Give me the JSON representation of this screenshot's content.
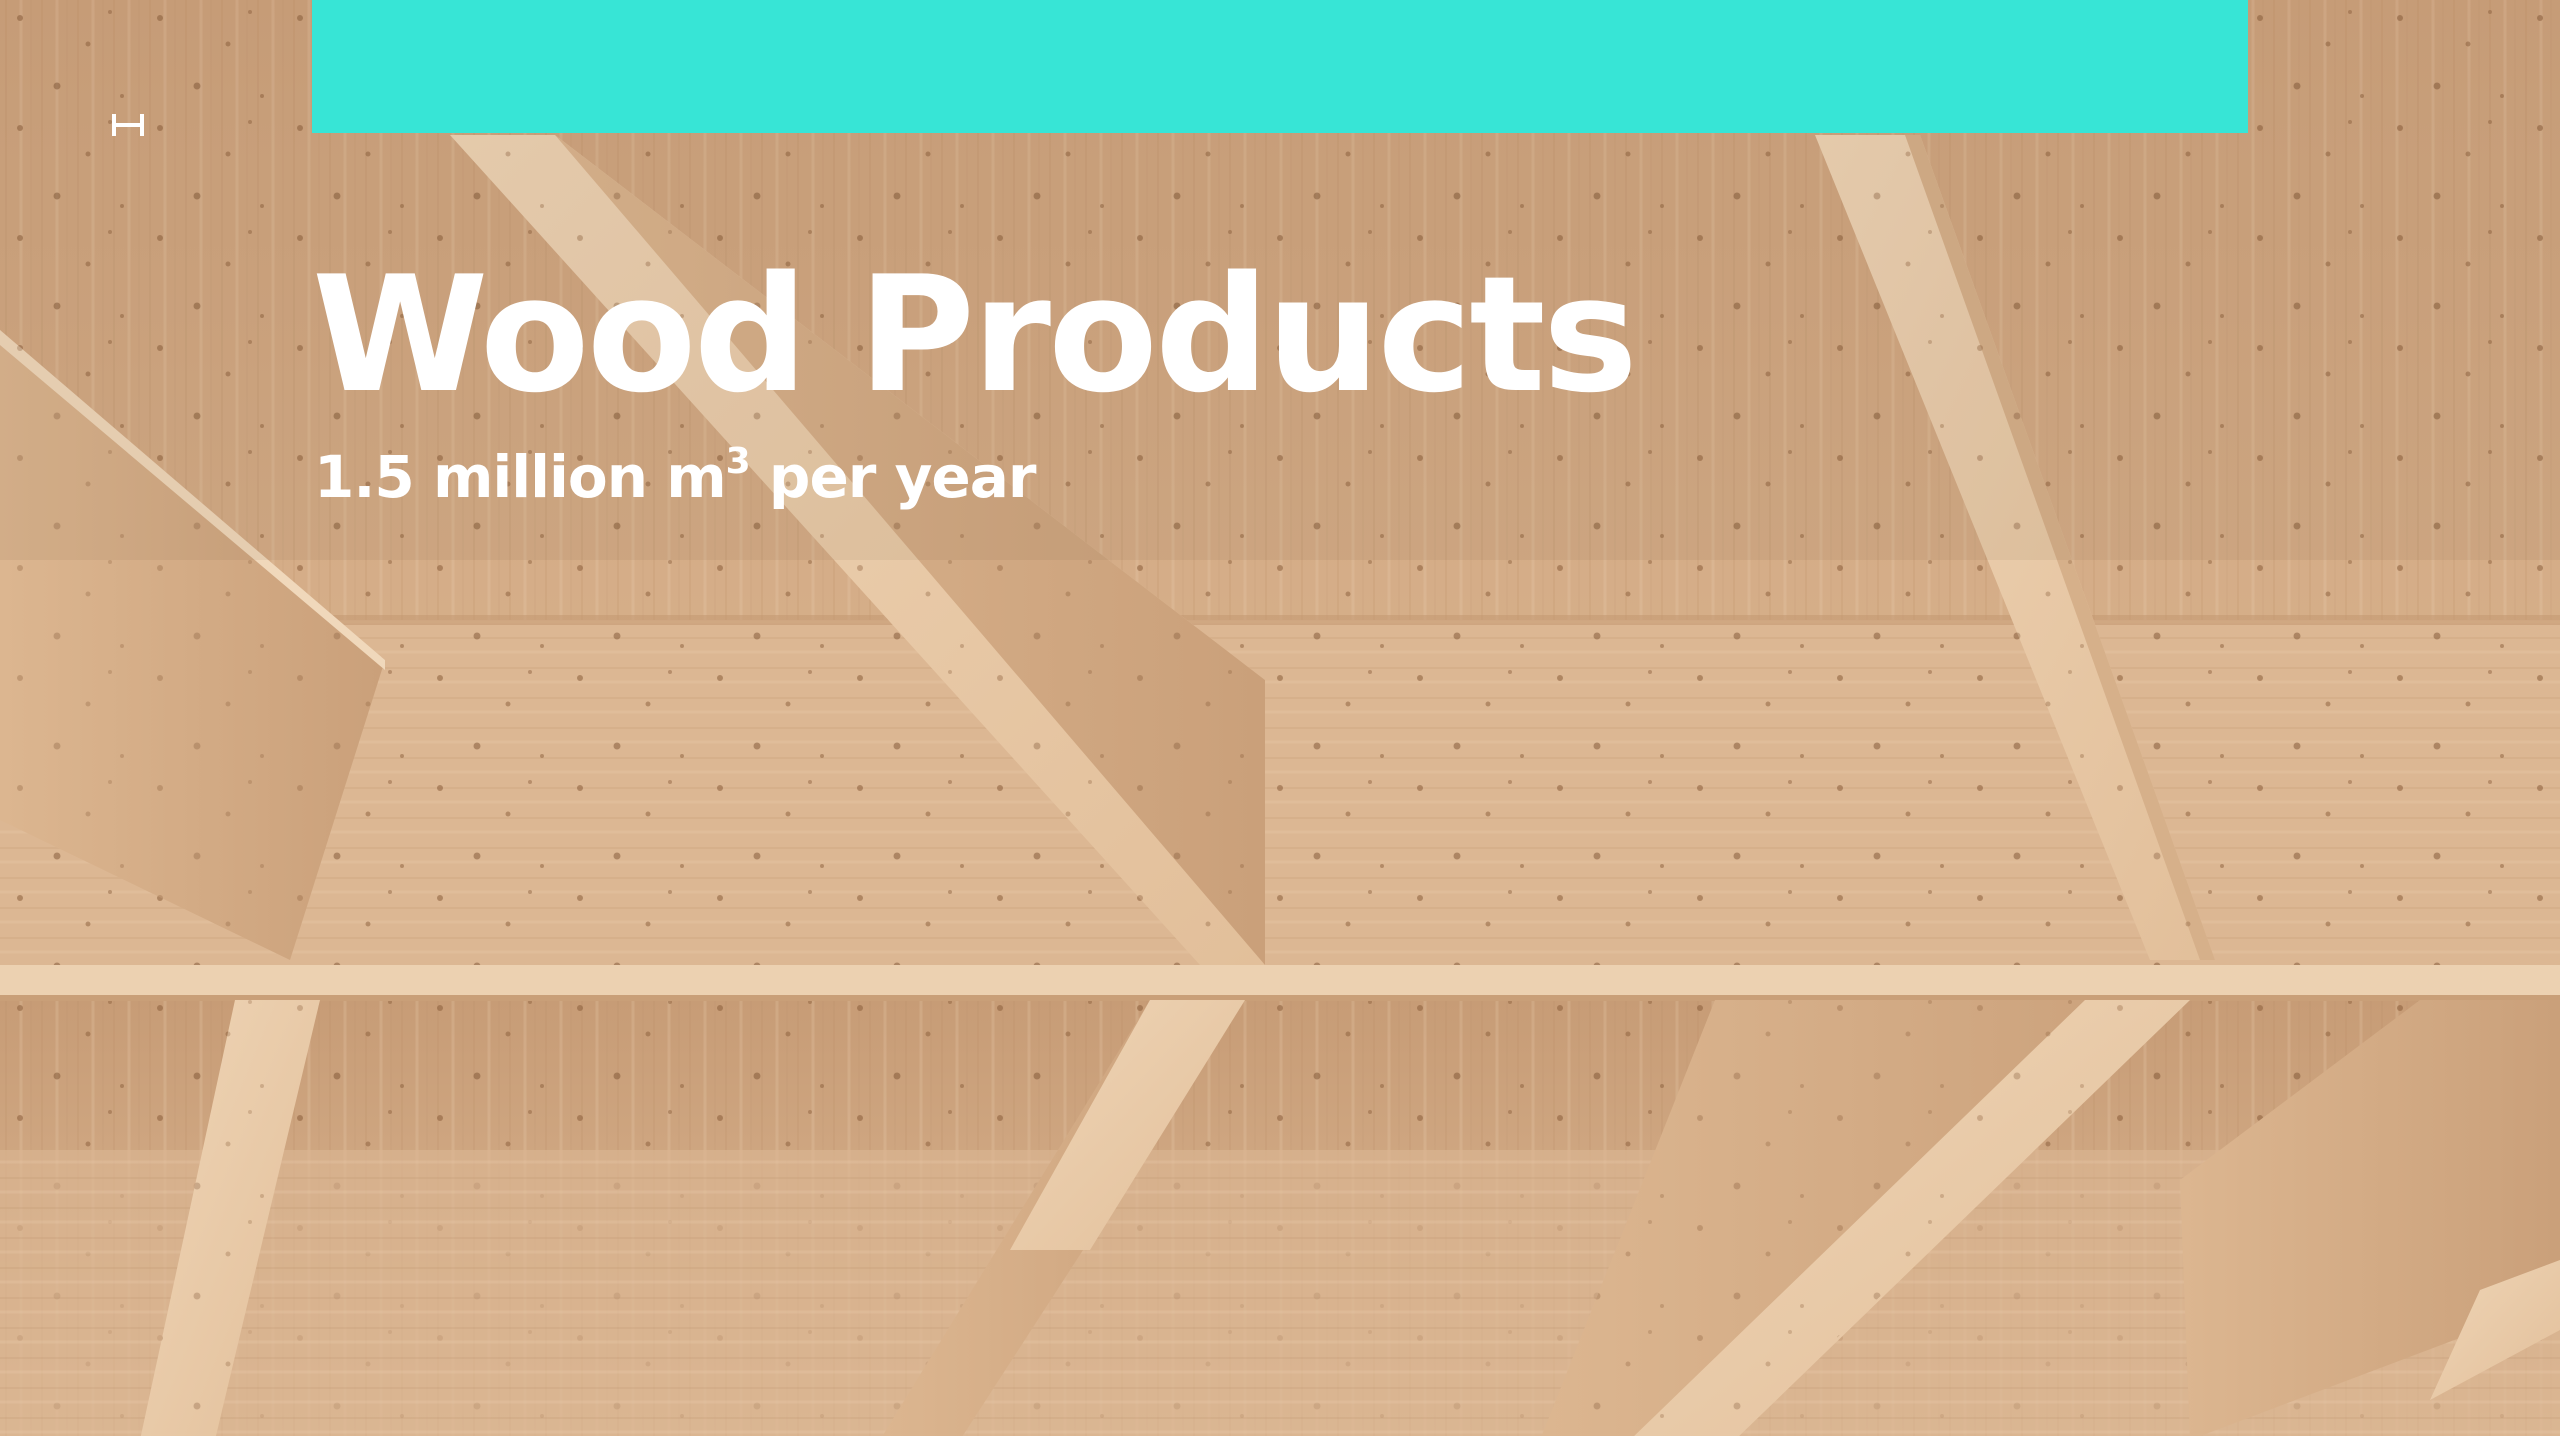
{
  "slide": {
    "title": "Wood Products",
    "subtitle_prefix": "1.5 million m",
    "subtitle_superscript": "3",
    "subtitle_suffix": " per year"
  },
  "logo": {
    "icon": "h-monogram-icon"
  },
  "background": {
    "image": "timber-ceiling-photo"
  },
  "colors": {
    "accent": "#37e5d6",
    "text": "#ffffff",
    "wood_light": "#e9c9a6",
    "wood_mid": "#d6ae87",
    "wood_dark": "#b98d66"
  }
}
